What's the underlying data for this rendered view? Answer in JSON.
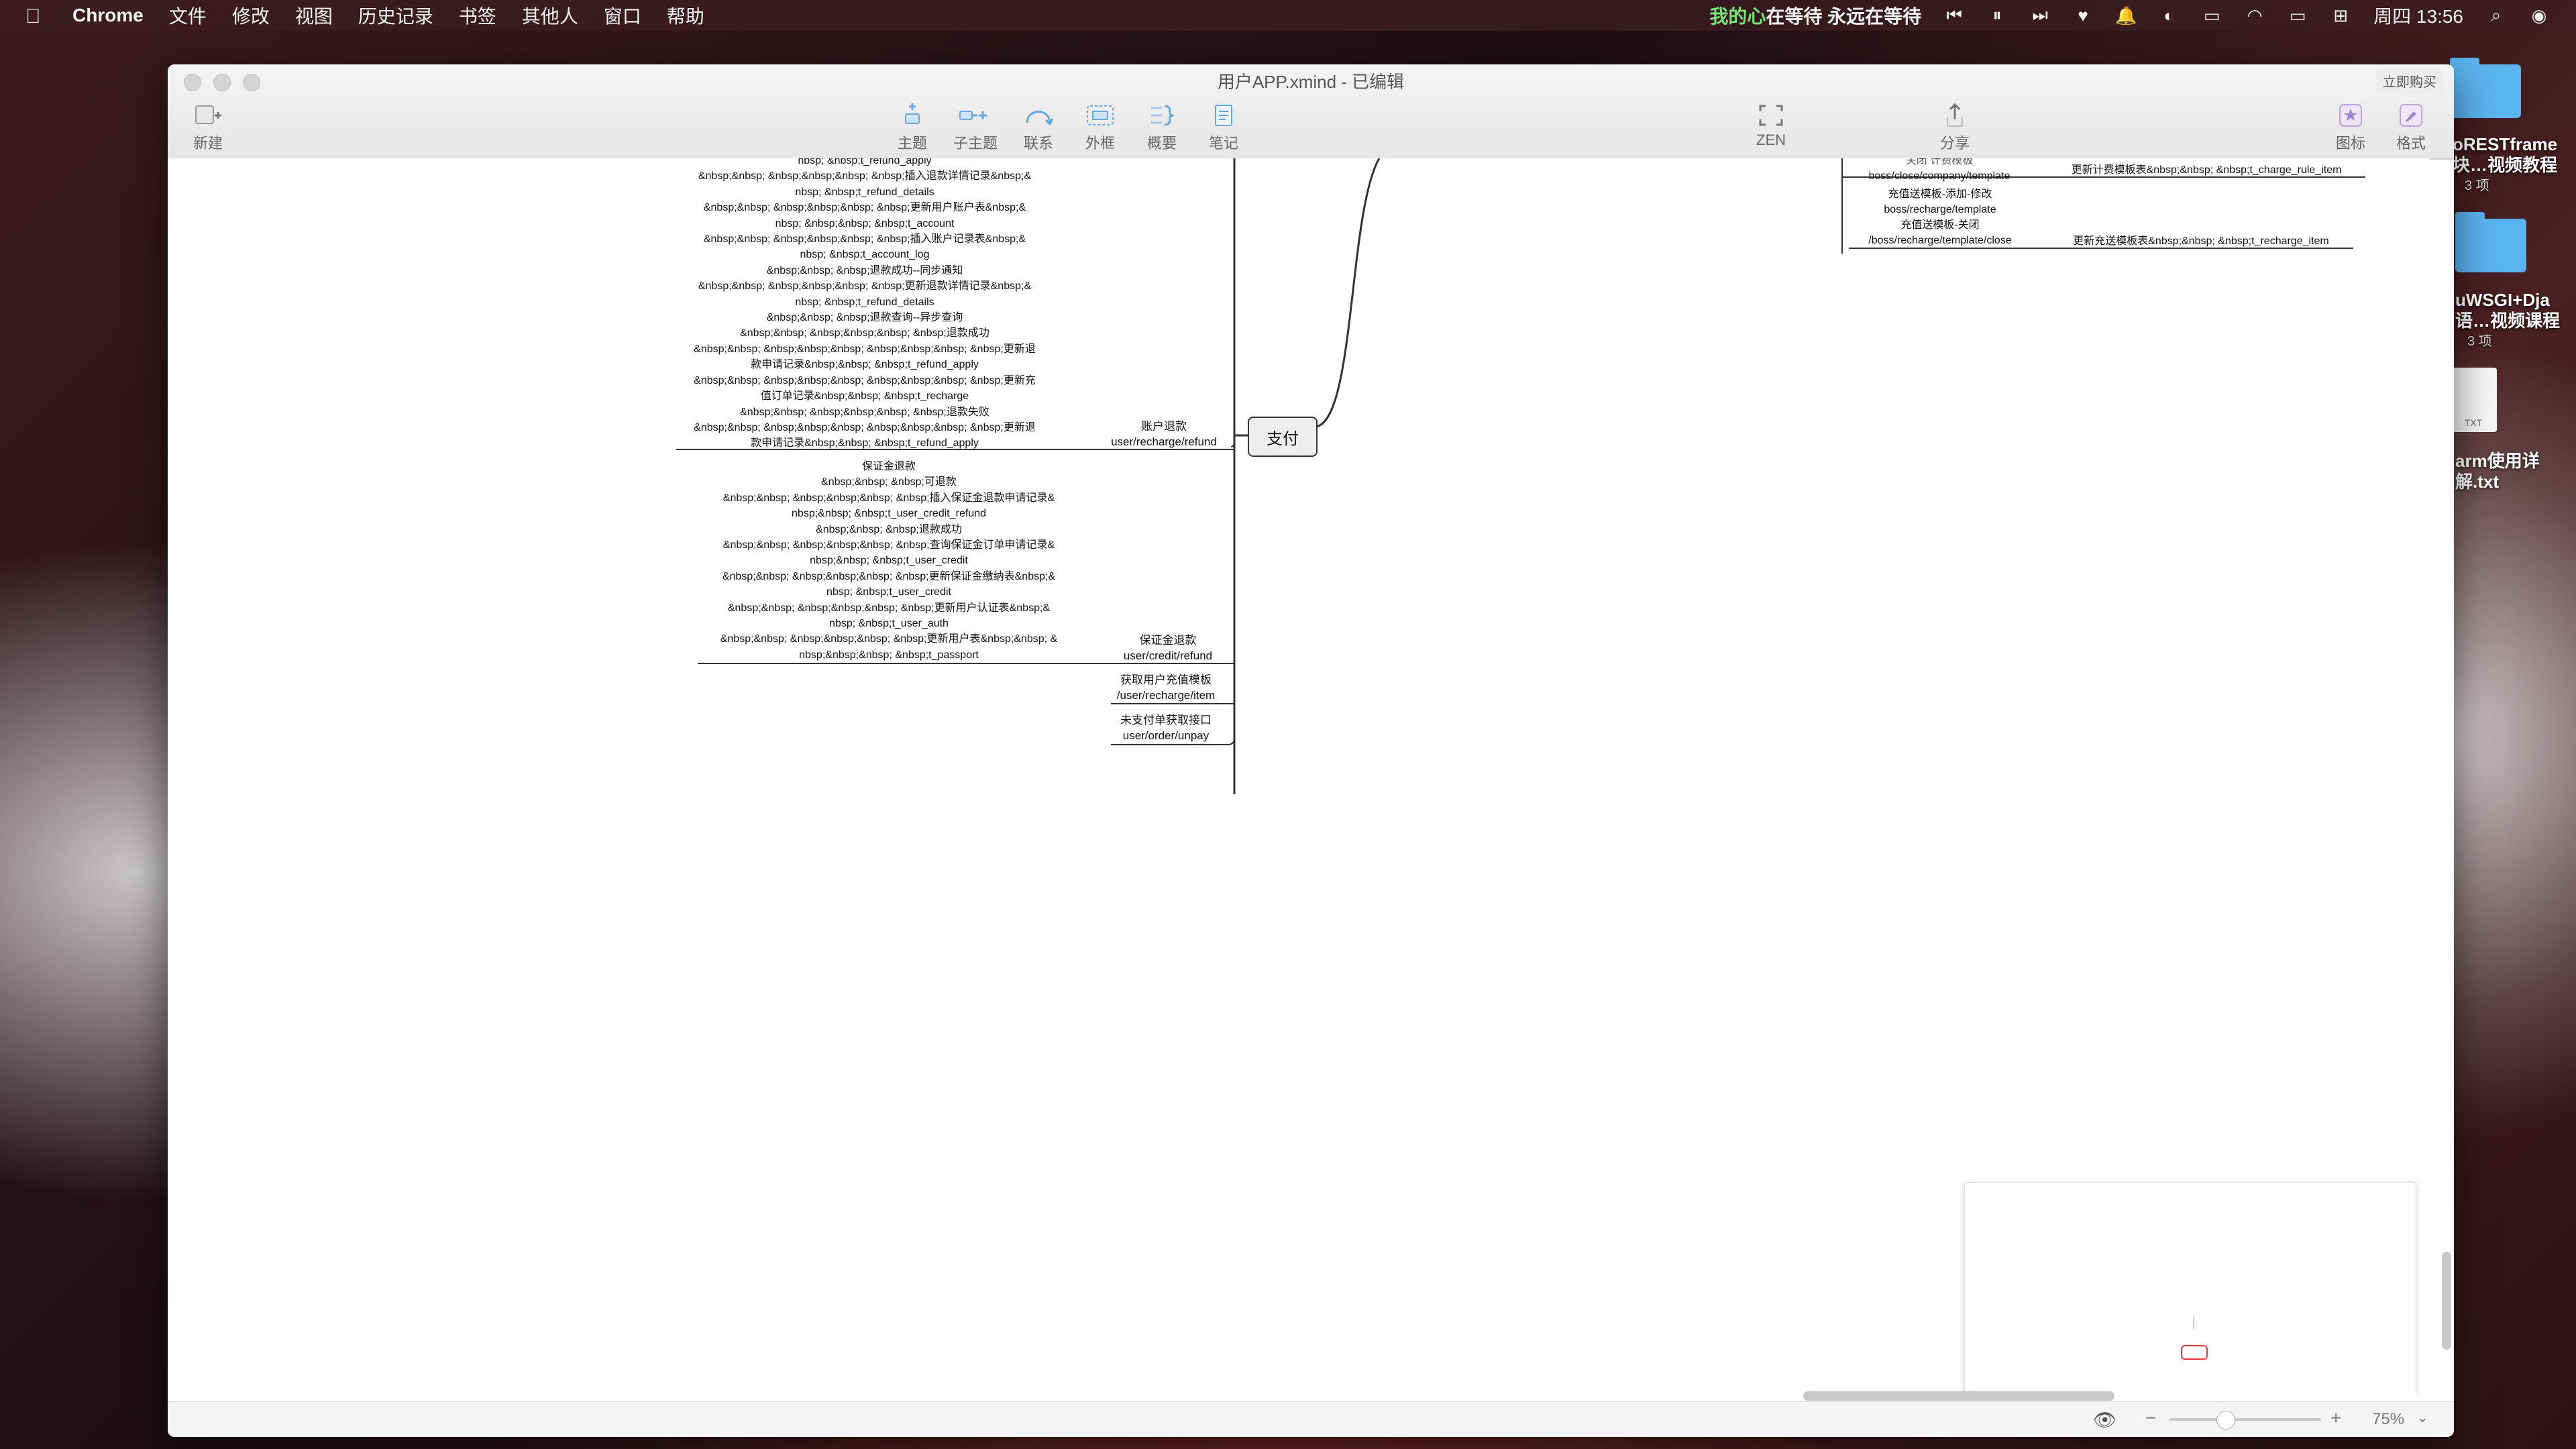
{
  "menubar": {
    "app": "Chrome",
    "menus": [
      "文件",
      "修改",
      "视图",
      "历史记录",
      "书签",
      "其他人",
      "窗口",
      "帮助"
    ],
    "now_playing_title": "我的心",
    "now_playing_rest": "在等待 永远在等待",
    "clock": "周四 13:56"
  },
  "window": {
    "title": "用户APP.xmind - 已编辑",
    "buy_label": "立即购买",
    "toolbar": {
      "new": "新建",
      "topic": "主题",
      "subtopic": "子主题",
      "relation": "联系",
      "boundary": "外框",
      "summary": "概要",
      "notes": "笔记",
      "zen": "ZEN",
      "share": "分享",
      "icons": "图标",
      "format": "格式"
    }
  },
  "mindmap": {
    "central_topic": "支付",
    "refund_details_lines": [
      "nbsp; &nbsp;t_refund_apply",
      "&nbsp;&nbsp; &nbsp;&nbsp;&nbsp; &nbsp;插入退款详情记录&nbsp;&",
      "nbsp; &nbsp;t_refund_details",
      "&nbsp;&nbsp; &nbsp;&nbsp;&nbsp; &nbsp;更新用户账户表&nbsp;&",
      "nbsp; &nbsp;&nbsp; &nbsp;t_account",
      "&nbsp;&nbsp; &nbsp;&nbsp;&nbsp; &nbsp;插入账户记录表&nbsp;&",
      "nbsp; &nbsp;t_account_log",
      "&nbsp;&nbsp; &nbsp;退款成功--同步通知",
      "&nbsp;&nbsp; &nbsp;&nbsp;&nbsp; &nbsp;更新退款详情记录&nbsp;&",
      "nbsp; &nbsp;t_refund_details",
      "&nbsp;&nbsp; &nbsp;退款查询--异步查询",
      "&nbsp;&nbsp; &nbsp;&nbsp;&nbsp; &nbsp;退款成功",
      "&nbsp;&nbsp; &nbsp;&nbsp;&nbsp; &nbsp;&nbsp;&nbsp; &nbsp;更新退",
      "款申请记录&nbsp;&nbsp; &nbsp;t_refund_apply",
      "&nbsp;&nbsp; &nbsp;&nbsp;&nbsp; &nbsp;&nbsp;&nbsp; &nbsp;更新充",
      "值订单记录&nbsp;&nbsp; &nbsp;t_recharge",
      "&nbsp;&nbsp; &nbsp;&nbsp;&nbsp; &nbsp;退款失败",
      "&nbsp;&nbsp; &nbsp;&nbsp;&nbsp; &nbsp;&nbsp;&nbsp; &nbsp;更新退",
      "款申请记录&nbsp;&nbsp; &nbsp;t_refund_apply"
    ],
    "account_refund": {
      "title": "账户退款",
      "path": "user/recharge/refund"
    },
    "credit_lines": [
      "保证金退款",
      "&nbsp;&nbsp; &nbsp;可退款",
      "&nbsp;&nbsp; &nbsp;&nbsp;&nbsp; &nbsp;插入保证金退款申请记录&",
      "nbsp;&nbsp; &nbsp;t_user_credit_refund",
      "&nbsp;&nbsp; &nbsp;退款成功",
      "&nbsp;&nbsp; &nbsp;&nbsp;&nbsp; &nbsp;查询保证金订单申请记录&",
      "nbsp;&nbsp; &nbsp;t_user_credit",
      "&nbsp;&nbsp; &nbsp;&nbsp;&nbsp; &nbsp;更新保证金缴纳表&nbsp;&",
      "nbsp; &nbsp;t_user_credit",
      "&nbsp;&nbsp; &nbsp;&nbsp;&nbsp; &nbsp;更新用户认证表&nbsp;&",
      "nbsp; &nbsp;t_user_auth",
      "&nbsp;&nbsp; &nbsp;&nbsp;&nbsp; &nbsp;更新用户表&nbsp;&nbsp; &",
      "nbsp;&nbsp;&nbsp; &nbsp;t_passport"
    ],
    "credit_refund": {
      "title": "保证金退款",
      "path": "user/credit/refund"
    },
    "recharge_item": {
      "title": "获取用户充值模板",
      "path": "/user/recharge/item"
    },
    "unpay_order": {
      "title": "未支付单获取接口",
      "path": "user/order/unpay"
    },
    "right_partial_top": "关闭    计费模板",
    "right_close_path": "boss/close/company/template",
    "right_charge_rule": "更新计费模板表&nbsp;&nbsp; &nbsp;t_charge_rule_item",
    "recharge_template_lines": [
      "充值送模板-添加-修改",
      "boss/recharge/template",
      "充值送模板-关闭",
      "/boss/recharge/template/close"
    ],
    "recharge_item_update": "更新充送模板表&nbsp;&nbsp; &nbsp;t_recharge_item"
  },
  "statusbar": {
    "zoom": "75%"
  },
  "desktop": {
    "item1_title": "oRESTframe",
    "item1_title2": "块…视频教程",
    "item1_sub": "3 项",
    "item2_title": "uWSGI+Dja",
    "item2_title2": "语…视频课程",
    "item2_sub": "3 项",
    "item3_title": "arm使用详",
    "item3_title2": "解.txt",
    "txt_badge": "TXT"
  }
}
